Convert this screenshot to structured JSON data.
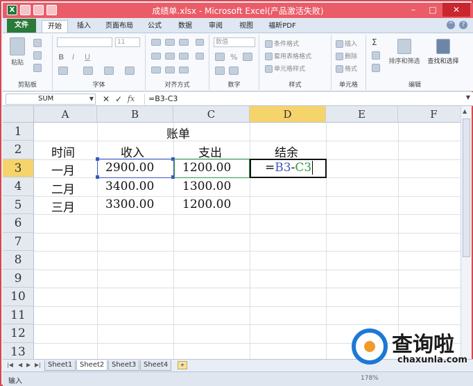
{
  "window": {
    "title": "成绩单.xlsx - Microsoft Excel(产品激活失败)",
    "controls": [
      "–",
      "□",
      "✕"
    ]
  },
  "ribbon_tabs": [
    "文件",
    "开始",
    "插入",
    "页面布局",
    "公式",
    "数据",
    "审阅",
    "视图",
    "福昕PDF"
  ],
  "ribbon": {
    "clipboard": {
      "label": "剪贴板",
      "paste": "粘贴"
    },
    "font": {
      "label": "字体",
      "size": "11",
      "bold": "B",
      "italic": "I",
      "underline": "U"
    },
    "alignment": {
      "label": "对齐方式"
    },
    "number": {
      "label": "数字",
      "format": "数值",
      "percent": "%"
    },
    "styles": {
      "label": "样式",
      "conditional": "条件格式",
      "table": "套用表格格式",
      "cell_styles": "单元格样式"
    },
    "cells": {
      "label": "单元格",
      "insert": "插入",
      "delete": "删除",
      "format": "格式"
    },
    "editing": {
      "label": "编辑",
      "sort_filter": "排序和筛选",
      "find_select": "查找和选择"
    }
  },
  "formula_bar": {
    "name_box": "SUM",
    "formula": "=B3-C3",
    "fx": "fx"
  },
  "columns": [
    "A",
    "B",
    "C",
    "D",
    "E",
    "F"
  ],
  "selected_column": "D",
  "rows": [
    "1",
    "2",
    "3",
    "4",
    "5",
    "6",
    "7",
    "8",
    "9",
    "10",
    "11",
    "12",
    "13"
  ],
  "selected_row": "3",
  "sheet": {
    "title": "账单",
    "headers": {
      "A": "时间",
      "B": "收入",
      "C": "支出",
      "D": "结余"
    },
    "data": [
      {
        "A": "一月",
        "B": "2900.00",
        "C": "1200.00"
      },
      {
        "A": "二月",
        "B": "3400.00",
        "C": "1300.00"
      },
      {
        "A": "三月",
        "B": "3300.00",
        "C": "1200.00"
      }
    ],
    "editing_cell": {
      "ref": "D3",
      "prefix": "=",
      "ref1": "B3",
      "op": "-",
      "ref2": "C3"
    }
  },
  "sheet_tabs": [
    "Sheet1",
    "Sheet2",
    "Sheet3",
    "Sheet4"
  ],
  "active_sheet": "Sheet2",
  "status": {
    "mode": "输入",
    "zoom": "178%"
  },
  "watermark": {
    "cn": "查询啦",
    "en": "chaxunla.com"
  },
  "colors": {
    "title_bar": "#ea5c68",
    "file_tab": "#2a7a3a",
    "selection_header": "#f5d46c",
    "ref_b": "#3a58c2",
    "ref_c": "#2f9a48"
  }
}
